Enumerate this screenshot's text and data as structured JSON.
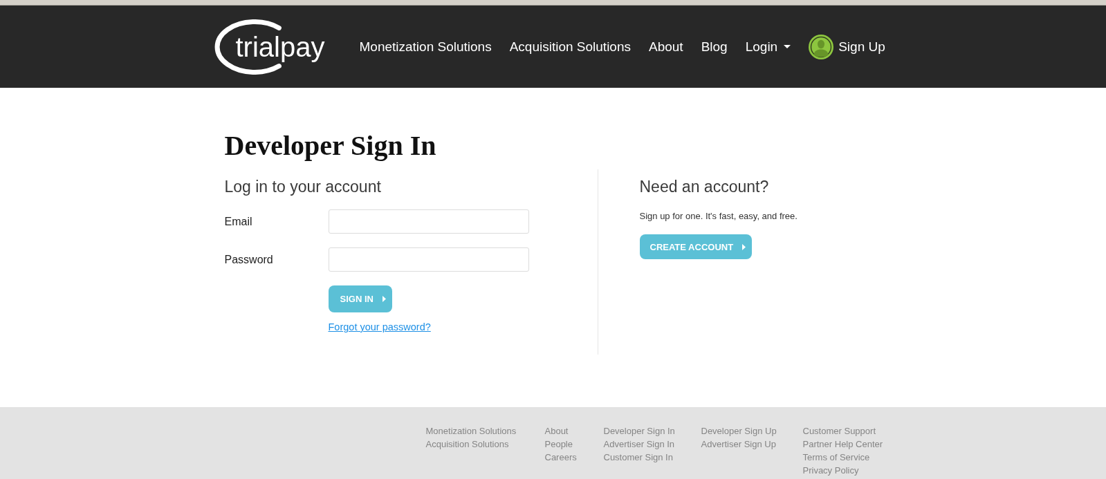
{
  "header": {
    "logo": "trialpay",
    "nav": [
      {
        "label": "Monetization Solutions",
        "kind": "link"
      },
      {
        "label": "Acquisition Solutions",
        "kind": "link"
      },
      {
        "label": "About",
        "kind": "link"
      },
      {
        "label": "Blog",
        "kind": "link"
      },
      {
        "label": "Login",
        "kind": "dropdown"
      },
      {
        "label": "Sign Up",
        "kind": "account"
      }
    ]
  },
  "page_title": "Developer Sign In",
  "login": {
    "heading": "Log in to your account",
    "fields": [
      {
        "label": "Email"
      },
      {
        "label": "Password"
      }
    ],
    "submit": "SIGN IN",
    "forgot_link": "Forgot your password?"
  },
  "signup": {
    "heading": "Need an account?",
    "text": "Sign up for one. It's fast, easy, and free.",
    "button": "CREATE ACCOUNT"
  },
  "footer": {
    "columns": [
      {
        "links": [
          "Monetization Solutions",
          "Acquisition Solutions"
        ]
      },
      {
        "links": [
          "About",
          "People",
          "Careers"
        ]
      },
      {
        "links": [
          "Developer Sign In",
          "Advertiser Sign In",
          "Customer Sign In"
        ]
      },
      {
        "links": [
          "Developer Sign Up",
          "Advertiser Sign Up"
        ]
      },
      {
        "links": [
          "Customer Support",
          "Partner Help Center",
          "Terms of Service",
          "Privacy Policy"
        ]
      }
    ]
  }
}
